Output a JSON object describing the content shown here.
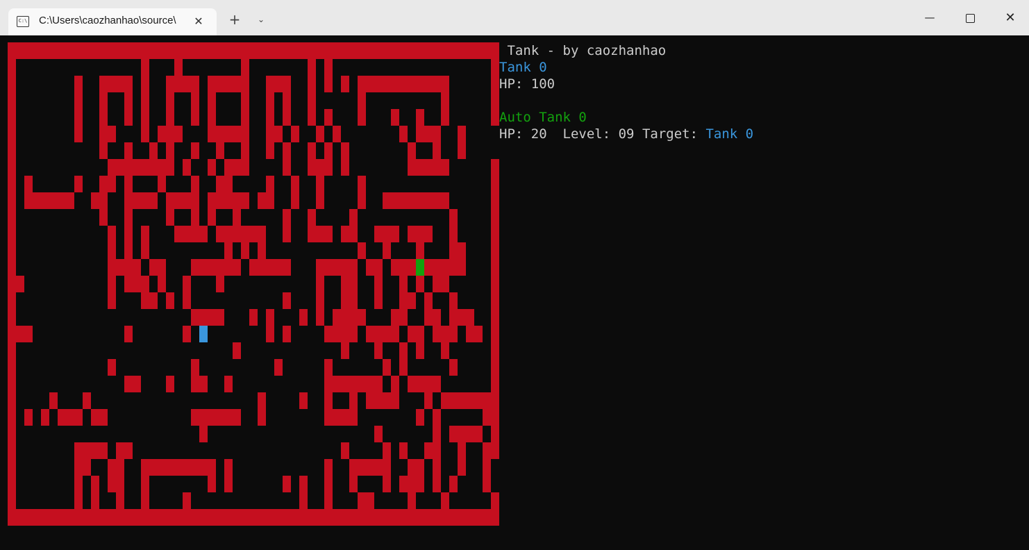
{
  "window": {
    "tab_title": "C:\\Users\\caozhanhao\\source\\",
    "tab_icon": "terminal-icon",
    "close_tab_glyph": "✕",
    "new_tab_glyph": "+",
    "dropdown_glyph": "⌄",
    "minimize_glyph": "—",
    "close_glyph": "✕"
  },
  "game": {
    "title": " Tank - by caozhanhao",
    "player": {
      "name": "Tank 0",
      "hp_label": "HP: ",
      "hp": "100",
      "color": "#3a96dd"
    },
    "auto_tank": {
      "name": "Auto Tank 0",
      "hp_label": "HP: ",
      "hp": "20",
      "level_label": "  Level: ",
      "level": "09",
      "target_label": " Target: ",
      "target": "Tank 0",
      "color": "#13a10e"
    }
  },
  "colors": {
    "wall": "#c50f1f",
    "terminal_bg": "#0c0c0c",
    "text": "#cccccc",
    "player": "#3a96dd",
    "auto_tank": "#13a10e"
  },
  "map": {
    "cols": 59,
    "rows": 29,
    "player_cell": [
      23,
      17
    ],
    "auto_tank_cell": [
      49,
      13
    ],
    "grid": [
      "###########################################################",
      "#...............#...#.......#.......#.#...................#",
      "#.......#..####.#..####.#####..###..#.#.#.###########.....#",
      "#.......#..#..#.#..#..#.#...#..#.#..#.....#.........#.....#",
      "#.......#..#..#.#..#..#.#...#..#.#..#.#...#...#..#..#.....#",
      "#.......#..##...#.###...#####..##.#..#.#.......#.###..#....#",
      "#..........#..#..#.#..#..#..#..#.#..#.#.#.......#..#..#....#",
      "#...........########.#..#.###....#..###.#.......#####.....#",
      "#.#.....#..##.#...#...#..##....#..#..#....#...............#",
      "#.######..##..####.####.#####.##..#..#....#..########.....#",
      "#..........#..#....#..#.#..#.....#..#....#...........#....#",
      "#...........#.#.#...####.######..#..###.##..###.###..#....#",
      "#...........#.#.#.........#.#.#...........#..#...#...##...#",
      "#...........####.##...######.#####...#####.##.#########...#",
      "##..........#.###.#..#...#...........#..##..#..#.#.##.....#",
      "#...........#...##.#.#...........#...#..##..#..##.#..#....#",
      "#.....................####...#.#...#.#.####...##..##.###..#",
      "###...........#......#.........#.#....####.####.##.###.##.#",
      "#..........................#............#...#..#.#..#.....#",
      "#...........#.........#.........#.....#......#.#.....#....#",
      "#.............##...#..##..#...........#######.#.####......#",
      "#....#...#....................#....#..#..#.####...#.#######",
      "#.#.#.###.##..........######..#.......####.......#.#.....##",
      "#......................#....................#......#.####.#",
      "#.......####.##.........................#....#.#..##..#..##",
      "#.......##..##..#########.#...........#..#####..##.#..#..#.",
      "#.......#.#.##..#.......#.#......#.#..#..#...#.###.#.#...#.",
      "#.......#.#..#..#....#.............#..#...##....#...#.....#",
      "###########################################################"
    ]
  }
}
